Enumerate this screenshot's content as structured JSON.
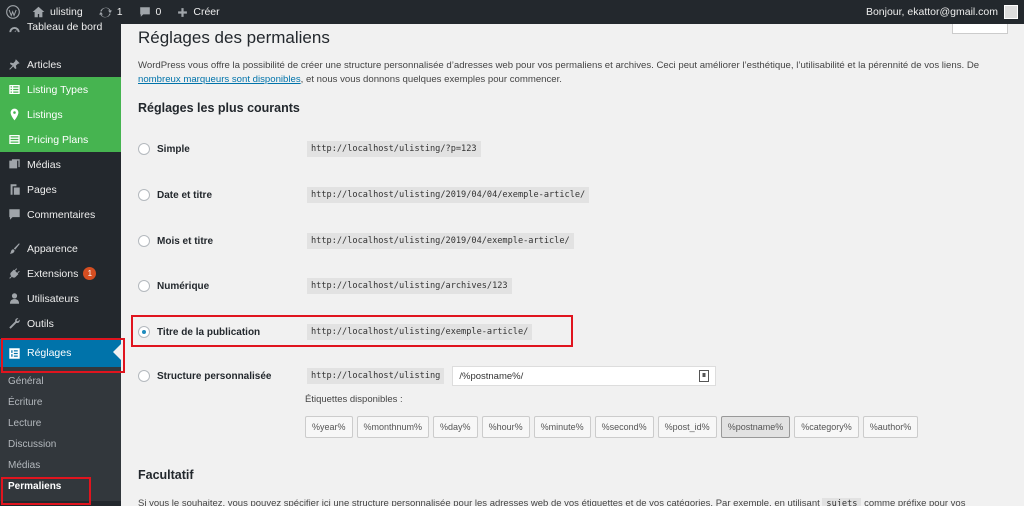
{
  "adminbar": {
    "site_name": "ulisting",
    "updates_count": "1",
    "comments_count": "0",
    "new_label": "Créer",
    "greeting": "Bonjour, ekattor@gmail.com"
  },
  "sidebar": {
    "dashboard": "Tableau de bord",
    "items": [
      {
        "label": "Articles"
      },
      {
        "label": "Listing Types"
      },
      {
        "label": "Listings"
      },
      {
        "label": "Pricing Plans"
      },
      {
        "label": "Médias"
      },
      {
        "label": "Pages"
      },
      {
        "label": "Commentaires"
      },
      {
        "label": "Apparence"
      },
      {
        "label": "Extensions",
        "badge": "1"
      },
      {
        "label": "Utilisateurs"
      },
      {
        "label": "Outils"
      },
      {
        "label": "Réglages"
      }
    ],
    "submenu": [
      "Général",
      "Écriture",
      "Lecture",
      "Discussion",
      "Médias",
      "Permaliens"
    ]
  },
  "main": {
    "title": "Réglages des permaliens",
    "intro_before_link": "WordPress vous offre la possibilité de créer une structure personnalisée d’adresses web pour vos permaliens et archives. Ceci peut améliorer l’esthétique, l’utilisabilité et la pérennité de vos liens. De ",
    "intro_link": "nombreux marqueurs sont disponibles",
    "intro_after_link": ", et nous vous donnons quelques exemples pour commencer.",
    "common_heading": "Réglages les plus courants",
    "options": [
      {
        "label": "Simple",
        "example": "http://localhost/ulisting/?p=123"
      },
      {
        "label": "Date et titre",
        "example": "http://localhost/ulisting/2019/04/04/exemple-article/"
      },
      {
        "label": "Mois et titre",
        "example": "http://localhost/ulisting/2019/04/exemple-article/"
      },
      {
        "label": "Numérique",
        "example": "http://localhost/ulisting/archives/123"
      },
      {
        "label": "Titre de la publication",
        "example": "http://localhost/ulisting/exemple-article/"
      },
      {
        "label": "Structure personnalisée",
        "example": "http://localhost/ulisting"
      }
    ],
    "custom_value": "/%postname%/",
    "tags_label": "Étiquettes disponibles :",
    "tags": [
      "%year%",
      "%monthnum%",
      "%day%",
      "%hour%",
      "%minute%",
      "%second%",
      "%post_id%",
      "%postname%",
      "%category%",
      "%author%"
    ],
    "optional_heading": "Facultatif",
    "optional_text_before": "Si vous le souhaitez, vous pouvez spécifier ici une structure personnalisée pour les adresses web de vos étiquettes et de vos catégories. Par exemple, en utilisant",
    "optional_code": "sujets",
    "optional_text_after": "comme préfixe pour vos"
  }
}
